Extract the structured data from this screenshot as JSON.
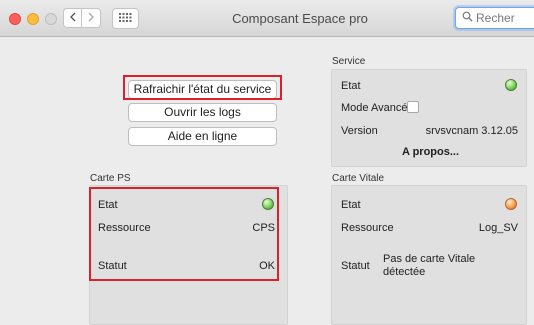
{
  "window": {
    "title": "Composant Espace pro",
    "search_placeholder": "Recher"
  },
  "actions": {
    "refresh_label": "Rafraichir l'état du service",
    "logs_label": "Ouvrir les logs",
    "help_label": "Aide en ligne"
  },
  "service": {
    "group_label": "Service",
    "etat_label": "Etat",
    "etat_status": "green",
    "mode_label": "Mode Avancé",
    "version_label": "Version",
    "version_value": "srvsvcnam 3.12.05",
    "apropos_label": "A propos..."
  },
  "carte_ps": {
    "group_label": "Carte PS",
    "etat_label": "Etat",
    "etat_status": "green",
    "ressource_label": "Ressource",
    "ressource_value": "CPS",
    "statut_label": "Statut",
    "statut_value": "OK"
  },
  "carte_vitale": {
    "group_label": "Carte Vitale",
    "etat_label": "Etat",
    "etat_status": "orange",
    "ressource_label": "Ressource",
    "ressource_value": "Log_SV",
    "statut_label": "Statut",
    "statut_value_line1": "Pas de carte Vitale",
    "statut_value_line2": "détectée"
  },
  "icons": [
    "chevron-left-icon",
    "chevron-right-icon",
    "grid-icon",
    "search-icon",
    "status-led-icon",
    "checkbox-icon"
  ],
  "colors": {
    "highlight": "#d9222a",
    "led_green": "#7ad15a",
    "led_orange": "#f6a24a"
  }
}
